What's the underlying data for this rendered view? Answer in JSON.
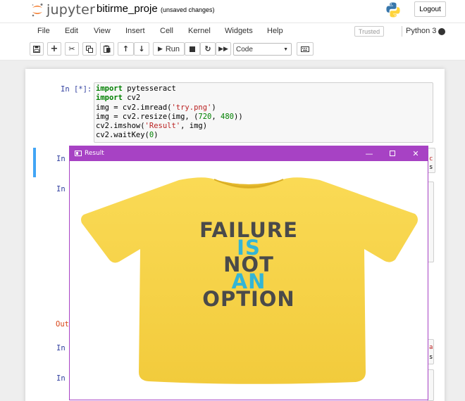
{
  "header": {
    "logo_text": "jupyter",
    "notebook_name": "bitirme_proje",
    "save_status": "(unsaved changes)",
    "logout_label": "Logout"
  },
  "menubar": {
    "items": [
      "File",
      "Edit",
      "View",
      "Insert",
      "Cell",
      "Kernel",
      "Widgets",
      "Help"
    ],
    "trusted_label": "Trusted",
    "kernel_name": "Python 3"
  },
  "toolbar": {
    "run_label": "Run",
    "cell_type": "Code"
  },
  "cells": {
    "cell1_prompt": "In [*]:",
    "cell2_prompt": "In",
    "cell3_prompt": "In",
    "out_prompt": "Out",
    "cell4_prompt": "In",
    "cell5_prompt": "In",
    "code_lines": [
      "import pytesseract",
      "import cv2",
      "img = cv2.imread('try.png')",
      "img = cv2.resize(img, (720, 480))",
      "cv2.imshow('Result', img)",
      "cv2.waitKey(0)"
    ]
  },
  "cv_window": {
    "title": "Result",
    "shirt_lines": [
      "FAILURE",
      "IS",
      "NOT",
      "AN",
      "OPTION"
    ],
    "colors": {
      "titlebar": "#a742c4",
      "shirt": "#f7d34a",
      "text_dark": "#4a4a4a",
      "text_accent": "#33b5d6"
    }
  }
}
